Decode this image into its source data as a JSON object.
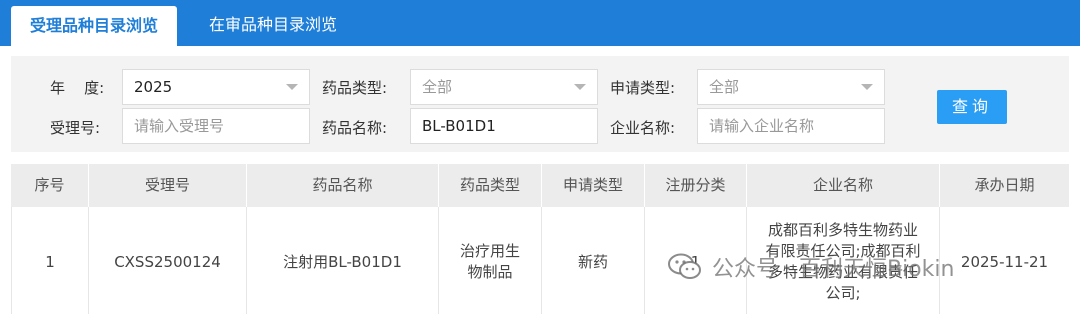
{
  "tabs": [
    {
      "label": "受理品种目录浏览",
      "active": true
    },
    {
      "label": "在审品种目录浏览",
      "active": false
    }
  ],
  "filters": {
    "year_label": "年    度:",
    "year_value": "2025",
    "drug_type_label": "药品类型:",
    "drug_type_value": "全部",
    "apply_type_label": "申请类型:",
    "apply_type_value": "全部",
    "accept_no_label": "受理号:",
    "accept_no_placeholder": "请输入受理号",
    "drug_name_label": "药品名称:",
    "drug_name_value": "BL-B01D1",
    "company_label": "企业名称:",
    "company_placeholder": "请输入企业名称",
    "query_button": "查询"
  },
  "table": {
    "columns": [
      "序号",
      "受理号",
      "药品名称",
      "药品类型",
      "申请类型",
      "注册分类",
      "企业名称",
      "承办日期"
    ],
    "rows": [
      {
        "index": "1",
        "accept_no": "CXSS2500124",
        "drug_name": "注射用BL-B01D1",
        "drug_type": "治疗用生物制品",
        "apply_type": "新药",
        "reg_class": "1",
        "company": "成都百利多特生物药业有限责任公司;成都百利多特生物药业有限责任公司;",
        "date": "2025-11-21"
      }
    ]
  },
  "watermark": {
    "icon": "wechat-icon",
    "text": "公众号 · 百利天恒Biokin"
  },
  "colors": {
    "tab_bar": "#1f7fd8",
    "query_button": "#2a9df4"
  }
}
